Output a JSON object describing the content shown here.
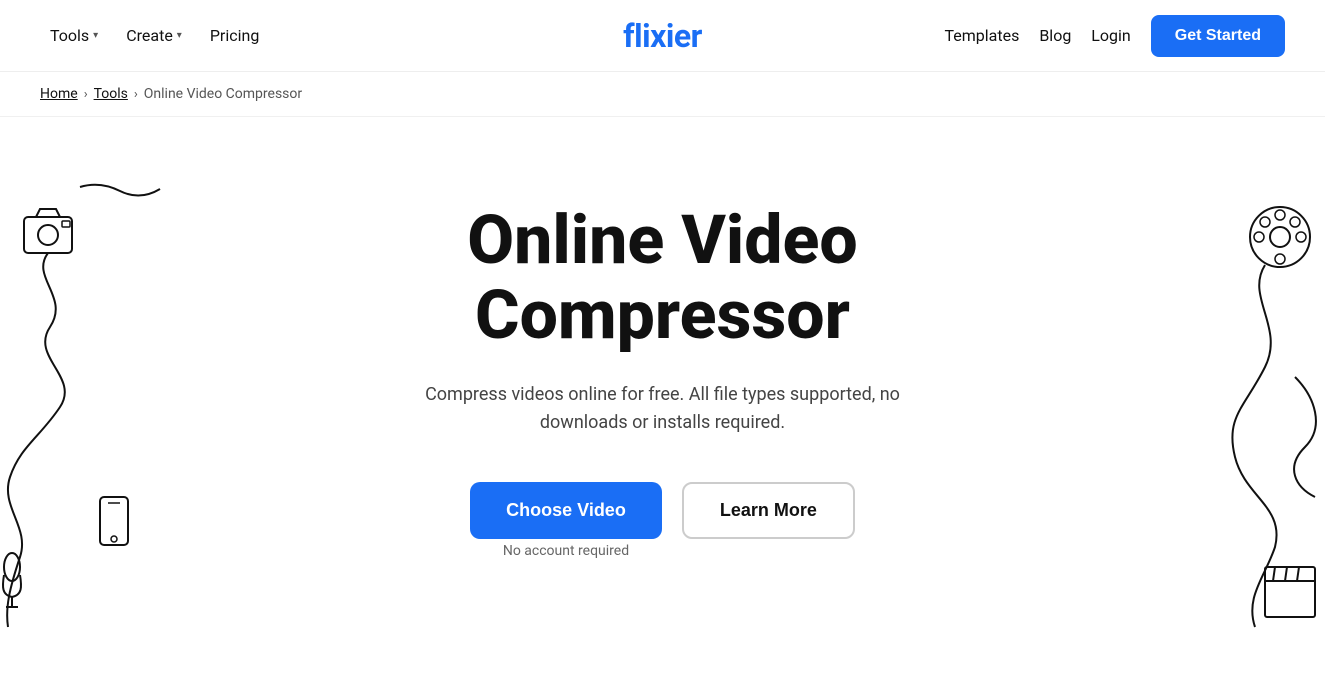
{
  "nav": {
    "logo": "flixier",
    "left_items": [
      {
        "label": "Tools",
        "has_dropdown": true
      },
      {
        "label": "Create",
        "has_dropdown": true
      },
      {
        "label": "Pricing",
        "has_dropdown": false
      }
    ],
    "right_items": [
      {
        "label": "Templates"
      },
      {
        "label": "Blog"
      },
      {
        "label": "Login"
      }
    ],
    "cta_label": "Get Started"
  },
  "breadcrumb": {
    "home": "Home",
    "tools": "Tools",
    "current": "Online Video Compressor"
  },
  "hero": {
    "title_line1": "Online Video",
    "title_line2": "Compressor",
    "subtitle": "Compress videos online for free. All file types supported, no downloads or installs required.",
    "choose_video_label": "Choose Video",
    "learn_more_label": "Learn More",
    "no_account_label": "No account required"
  }
}
